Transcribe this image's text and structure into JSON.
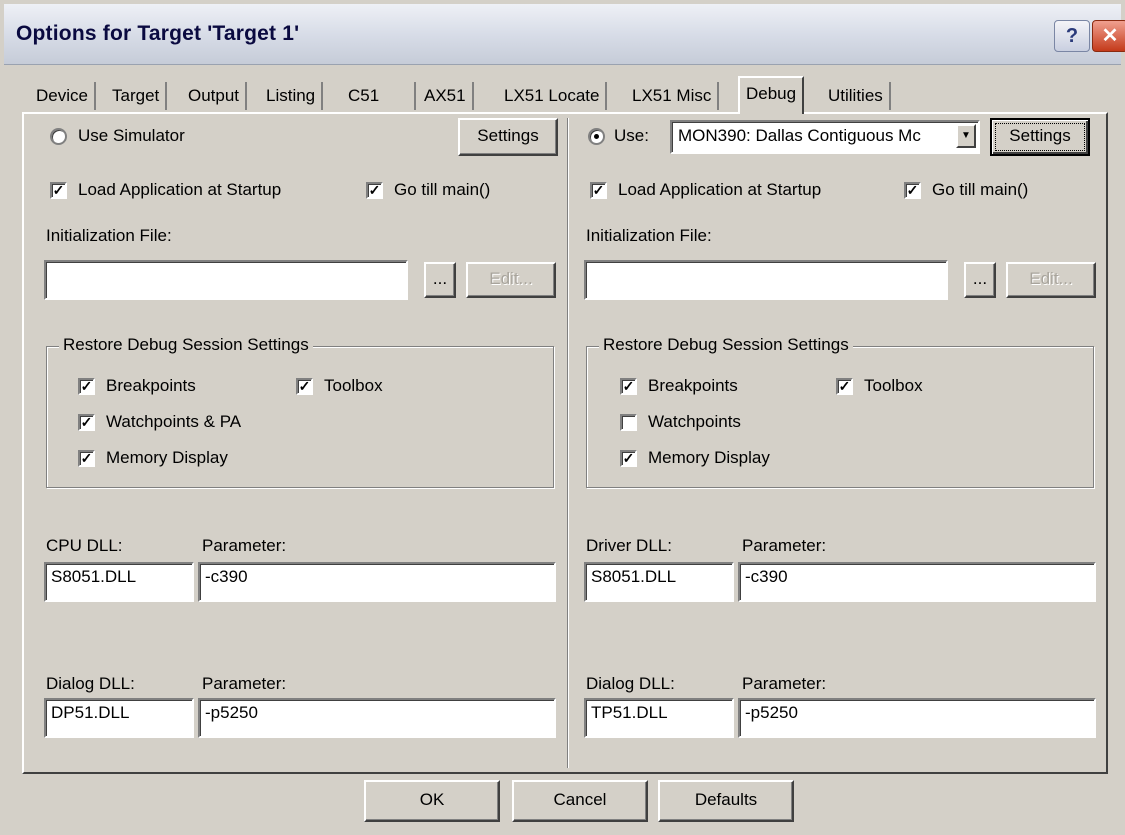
{
  "window": {
    "title": "Options for Target 'Target 1'",
    "help": "?",
    "close": "✕"
  },
  "tabs": [
    "Device",
    "Target",
    "Output",
    "Listing",
    "C51",
    "AX51",
    "LX51 Locate",
    "LX51 Misc",
    "Debug",
    "Utilities"
  ],
  "left": {
    "use_simulator": "Use Simulator",
    "settings": "Settings",
    "load_app": "Load Application at Startup",
    "go_main": "Go till main()",
    "init_file_label": "Initialization File:",
    "init_file_value": "",
    "browse": "...",
    "edit": "Edit...",
    "restore_title": "Restore Debug Session Settings",
    "breakpoints": "Breakpoints",
    "toolbox": "Toolbox",
    "watchpoints": "Watchpoints & PA",
    "memory": "Memory Display",
    "dll1_label": "CPU DLL:",
    "param1_label": "Parameter:",
    "dll1_value": "S8051.DLL",
    "param1_value": "-c390",
    "dll2_label": "Dialog DLL:",
    "param2_label": "Parameter:",
    "dll2_value": "DP51.DLL",
    "param2_value": "-p5250"
  },
  "right": {
    "use": "Use:",
    "driver_select": "MON390: Dallas Contiguous Mc",
    "settings": "Settings",
    "load_app": "Load Application at Startup",
    "go_main": "Go till main()",
    "init_file_label": "Initialization File:",
    "init_file_value": "",
    "browse": "...",
    "edit": "Edit...",
    "restore_title": "Restore Debug Session Settings",
    "breakpoints": "Breakpoints",
    "toolbox": "Toolbox",
    "watchpoints": "Watchpoints",
    "memory": "Memory Display",
    "dll1_label": "Driver DLL:",
    "param1_label": "Parameter:",
    "dll1_value": "S8051.DLL",
    "param1_value": "-c390",
    "dll2_label": "Dialog DLL:",
    "param2_label": "Parameter:",
    "dll2_value": "TP51.DLL",
    "param2_value": "-p5250"
  },
  "buttons": {
    "ok": "OK",
    "cancel": "Cancel",
    "defaults": "Defaults"
  },
  "check": "✓"
}
